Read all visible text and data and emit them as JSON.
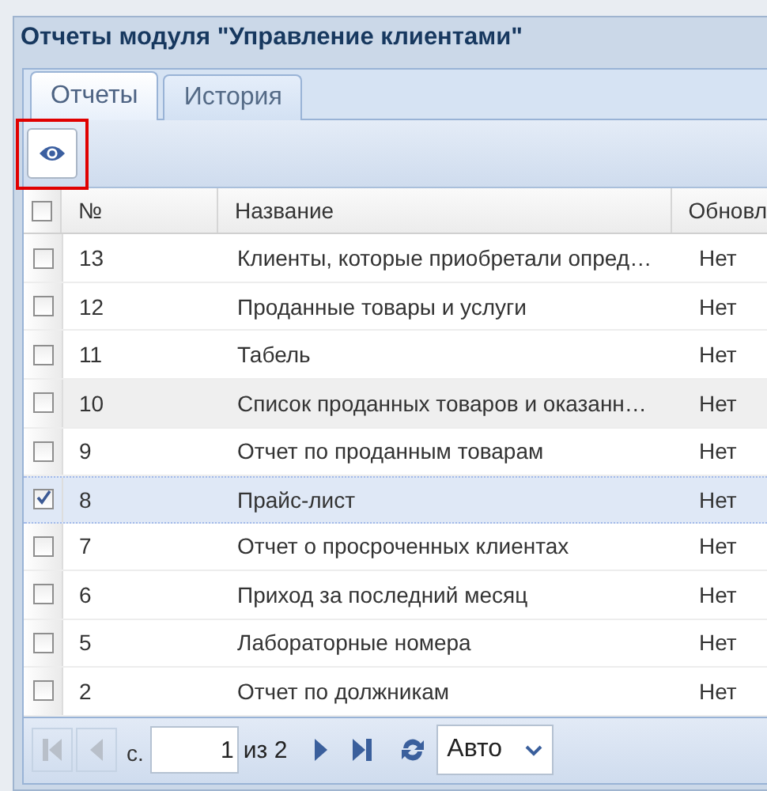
{
  "window": {
    "title": "Отчеты модуля \"Управление клиентами\""
  },
  "tabs": [
    {
      "label": "Отчеты",
      "selected": true
    },
    {
      "label": "История",
      "selected": false
    }
  ],
  "toolbar": {
    "highlighted": true
  },
  "table": {
    "columns": [
      "№",
      "Название",
      "Обновл"
    ],
    "all_checked": false,
    "rows": [
      {
        "number": "13",
        "name": "Клиенты, которые приобретали опред…",
        "updated": "Нет",
        "checked": false,
        "selected": false,
        "hovered": false
      },
      {
        "number": "12",
        "name": "Проданные товары и услуги",
        "updated": "Нет",
        "checked": false,
        "selected": false,
        "hovered": false
      },
      {
        "number": "11",
        "name": "Табель",
        "updated": "Нет",
        "checked": false,
        "selected": false,
        "hovered": false
      },
      {
        "number": "10",
        "name": "Список проданных товаров и оказанн…",
        "updated": "Нет",
        "checked": false,
        "selected": false,
        "hovered": true
      },
      {
        "number": "9",
        "name": "Отчет по проданным товарам",
        "updated": "Нет",
        "checked": false,
        "selected": false,
        "hovered": false
      },
      {
        "number": "8",
        "name": "Прайс-лист",
        "updated": "Нет",
        "checked": true,
        "selected": true,
        "hovered": false
      },
      {
        "number": "7",
        "name": "Отчет о просроченных клиентах",
        "updated": "Нет",
        "checked": false,
        "selected": false,
        "hovered": false
      },
      {
        "number": "6",
        "name": "Приход за последний месяц",
        "updated": "Нет",
        "checked": false,
        "selected": false,
        "hovered": false
      },
      {
        "number": "5",
        "name": "Лабораторные номера",
        "updated": "Нет",
        "checked": false,
        "selected": false,
        "hovered": false
      },
      {
        "number": "2",
        "name": "Отчет по должникам",
        "updated": "Нет",
        "checked": false,
        "selected": false,
        "hovered": false
      }
    ]
  },
  "pager": {
    "page_label": "с.",
    "page": "1",
    "total": "из 2",
    "page_size": "Авто",
    "first_disabled": true,
    "prev_disabled": true
  }
}
